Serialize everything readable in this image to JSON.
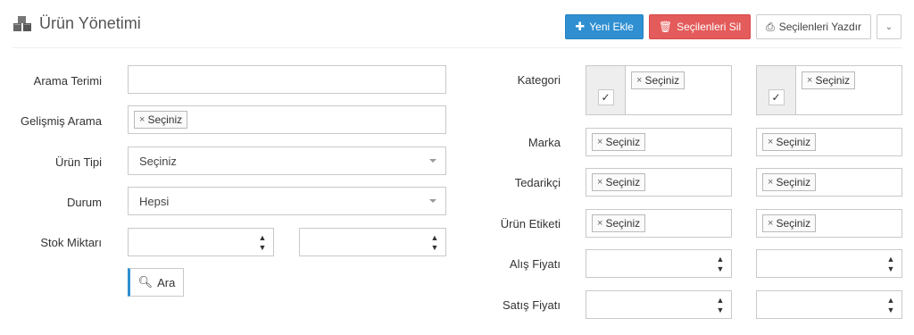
{
  "header": {
    "title": "Ürün Yönetimi",
    "icon": "boxes-icon"
  },
  "toolbar": {
    "add_label": "Yeni Ekle",
    "delete_label": "Seçilenleri Sil",
    "print_label": "Seçilenleri Yazdır",
    "colors": {
      "primary": "#2f8fd1",
      "danger": "#e35b5a"
    }
  },
  "left_form": {
    "search_term": {
      "label": "Arama Terimi",
      "value": ""
    },
    "advanced_search": {
      "label": "Gelişmiş Arama",
      "tag": "Seçiniz"
    },
    "product_type": {
      "label": "Ürün Tipi",
      "value": "Seçiniz"
    },
    "status": {
      "label": "Durum",
      "value": "Hepsi"
    },
    "stock": {
      "label": "Stok Miktarı",
      "min": "",
      "max": ""
    },
    "search_button": "Ara"
  },
  "right_form": {
    "category": {
      "label": "Kategori",
      "tag_a": "Seçiniz",
      "tag_b": "Seçiniz"
    },
    "brand": {
      "label": "Marka",
      "tag_a": "Seçiniz",
      "tag_b": "Seçiniz"
    },
    "supplier": {
      "label": "Tedarikçi",
      "tag_a": "Seçiniz",
      "tag_b": "Seçiniz"
    },
    "product_tag": {
      "label": "Ürün Etiketi",
      "tag_a": "Seçiniz",
      "tag_b": "Seçiniz"
    },
    "purchase_price": {
      "label": "Alış Fiyatı",
      "min": "",
      "max": ""
    },
    "sale_price": {
      "label": "Satış Fiyatı",
      "min": "",
      "max": ""
    }
  }
}
